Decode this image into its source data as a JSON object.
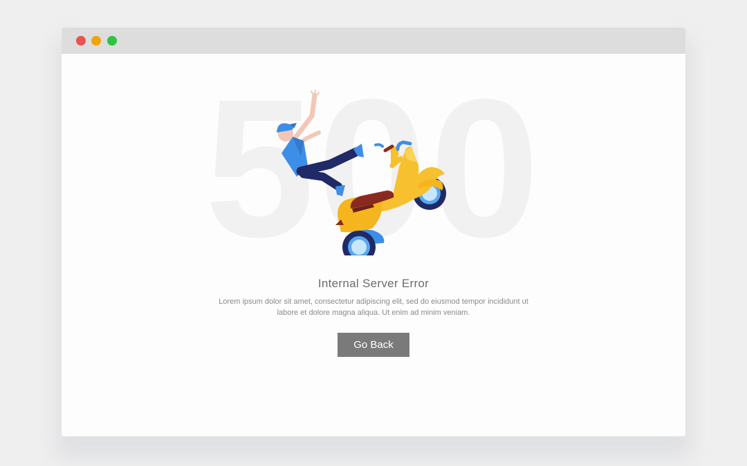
{
  "window": {
    "controls": [
      {
        "name": "close",
        "color": "#e85450"
      },
      {
        "name": "minimize",
        "color": "#f0a30b"
      },
      {
        "name": "maximize",
        "color": "#2ec440"
      }
    ]
  },
  "error": {
    "code": "500",
    "title": "Internal Server Error",
    "description": "Lorem ipsum dolor sit amet, consectetur adipiscing elit, sed do eiusmod tempor incididunt ut labore et dolore magna aliqua. Ut enim ad minim veniam.",
    "button_label": "Go Back"
  },
  "illustration": {
    "subject": "courier-falling-off-scooter",
    "colors": {
      "scooter": "#f7c02e",
      "seat": "#8a2a1e",
      "wheels": "#1f2a66",
      "shirt": "#3d8ee6",
      "pants": "#1f2a66",
      "skin": "#f3c7b5"
    }
  }
}
